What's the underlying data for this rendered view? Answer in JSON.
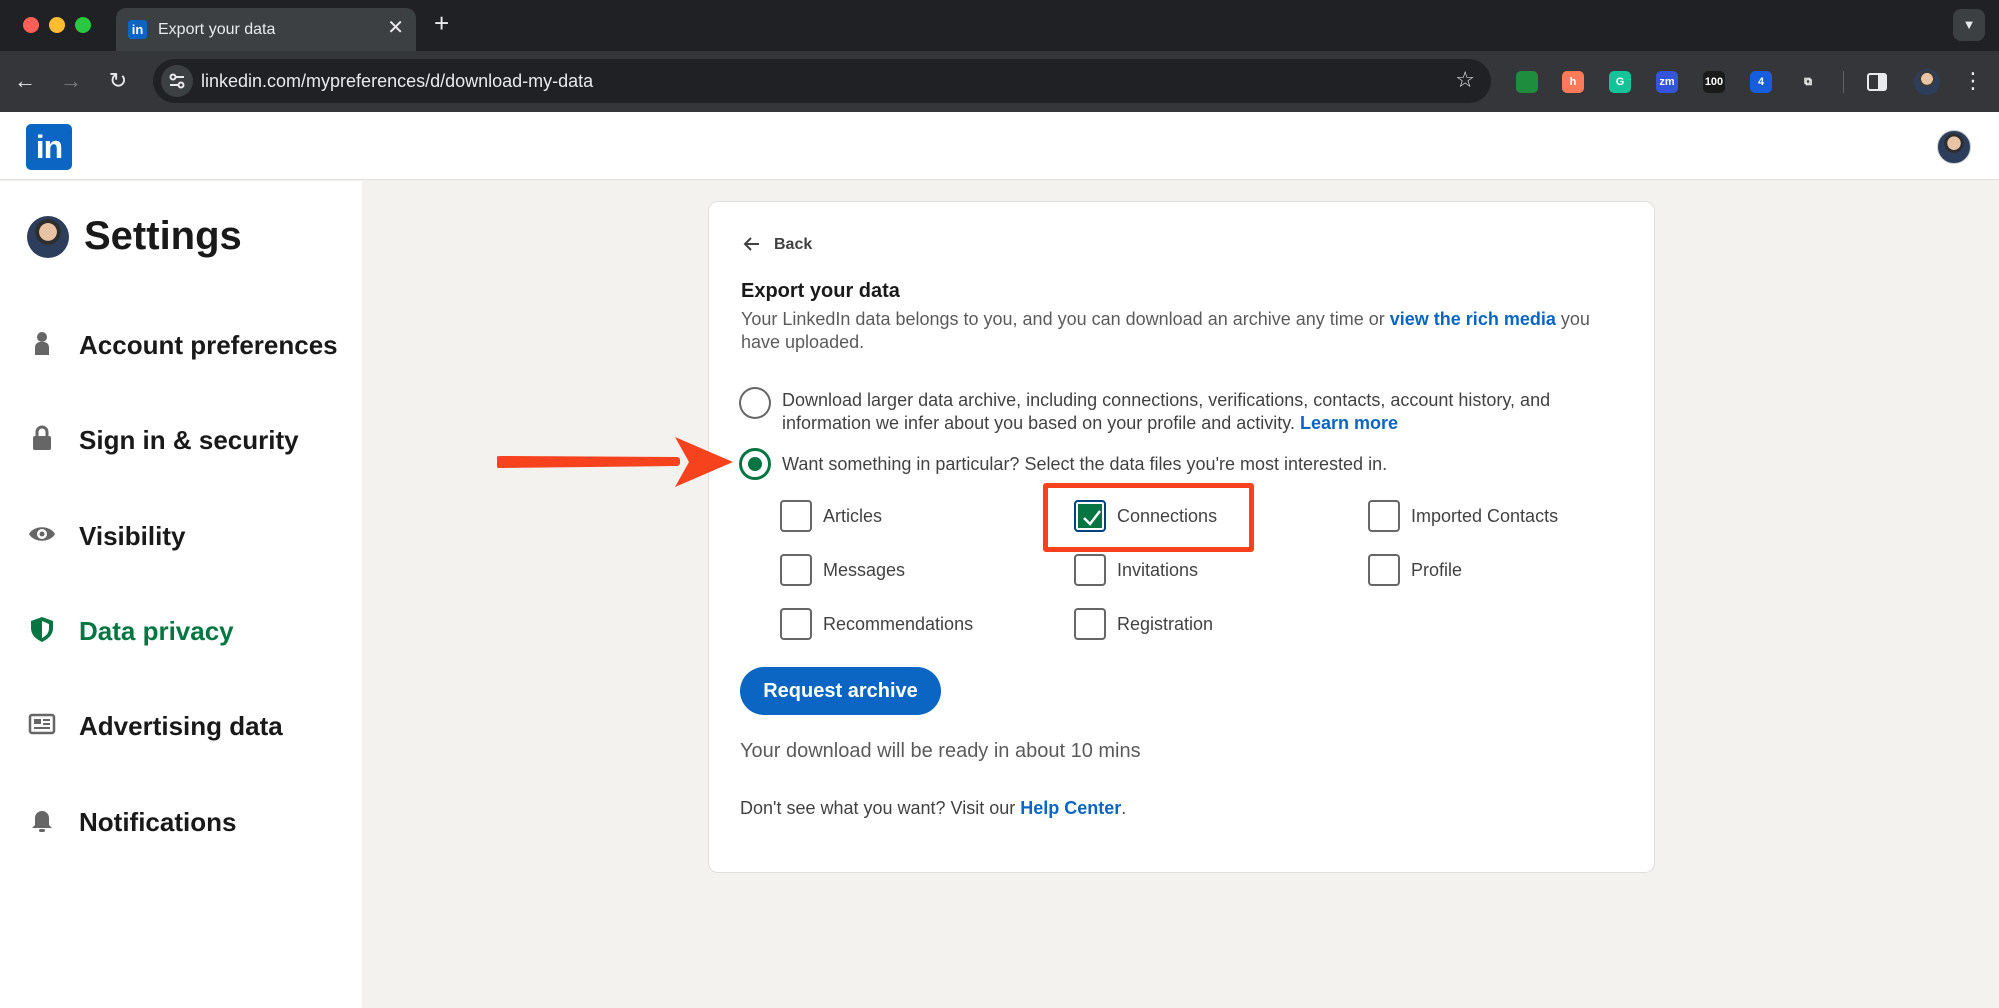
{
  "browser": {
    "tab_title": "Export your data",
    "tab_favicon": "in",
    "url": "linkedin.com/mypreferences/d/download-my-data",
    "extensions": [
      {
        "name": "google-drive-extension-icon",
        "label": "",
        "color": "#1e8e3e"
      },
      {
        "name": "hubspot-extension-icon",
        "label": "h",
        "color": "#ff7a59"
      },
      {
        "name": "grammarly-extension-icon",
        "label": "G",
        "color": "#15c39a"
      },
      {
        "name": "zoominfo-extension-icon",
        "label": "zm",
        "color": "#3455db"
      },
      {
        "name": "100-extension-icon",
        "label": "100",
        "color": "#1a1a1a"
      },
      {
        "name": "bitwarden-extension-icon",
        "label": "4",
        "color": "#175ddc"
      },
      {
        "name": "extensions-puzzle-icon",
        "label": "⧉",
        "color": "#35363a"
      }
    ]
  },
  "header": {
    "logo": "in"
  },
  "sidebar": {
    "title": "Settings",
    "items": [
      {
        "label": "Account preferences",
        "icon": "person-icon"
      },
      {
        "label": "Sign in & security",
        "icon": "lock-icon"
      },
      {
        "label": "Visibility",
        "icon": "eye-icon"
      },
      {
        "label": "Data privacy",
        "icon": "shield-icon",
        "active": true
      },
      {
        "label": "Advertising data",
        "icon": "newspaper-icon"
      },
      {
        "label": "Notifications",
        "icon": "bell-icon"
      }
    ]
  },
  "card": {
    "back_label": "Back",
    "title": "Export your data",
    "desc_prefix": "Your LinkedIn data belongs to you, and you can download an archive any time or ",
    "desc_link": "view the rich media",
    "desc_suffix": " you have uploaded.",
    "option_full_text": "Download larger data archive, including connections, verifications, contacts, account history, and information we infer about you based on your profile and activity. ",
    "option_full_link": "Learn more",
    "option_full_selected": false,
    "option_particular_text": "Want something in particular? Select the data files you're most interested in.",
    "option_particular_selected": true,
    "checkboxes": [
      {
        "label": "Articles",
        "checked": false
      },
      {
        "label": "Connections",
        "checked": true
      },
      {
        "label": "Imported Contacts",
        "checked": false
      },
      {
        "label": "Messages",
        "checked": false
      },
      {
        "label": "Invitations",
        "checked": false
      },
      {
        "label": "Profile",
        "checked": false
      },
      {
        "label": "Recommendations",
        "checked": false
      },
      {
        "label": "Registration",
        "checked": false
      }
    ],
    "request_button": "Request archive",
    "ready_text": "Your download will be ready in about 10 mins",
    "help_prefix": "Don't see what you want? Visit our ",
    "help_link": "Help Center",
    "help_suffix": "."
  },
  "colors": {
    "linkedin_blue": "#0a66c2",
    "active_green": "#057642",
    "annotation_red": "#f6421d"
  }
}
